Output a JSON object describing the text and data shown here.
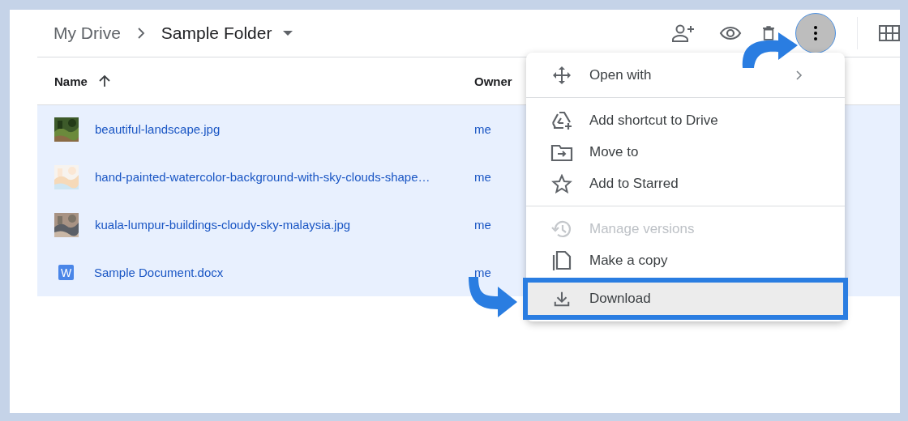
{
  "breadcrumb": [
    {
      "label": "My Drive",
      "current": false
    },
    {
      "label": "Sample Folder",
      "current": true
    }
  ],
  "table": {
    "columns": [
      "Name",
      "Owner"
    ],
    "rows": [
      {
        "name": "beautiful-landscape.jpg",
        "owner": "me",
        "selected": true
      },
      {
        "name": "hand-painted-watercolor-background-with-sky-clouds-shape…",
        "owner": "me",
        "selected": true
      },
      {
        "name": "kuala-lumpur-buildings-cloudy-sky-malaysia.jpg",
        "owner": "me",
        "selected": true
      },
      {
        "name": "Sample Document.docx",
        "owner": "me",
        "kind": "document",
        "badge": "W",
        "selected": true
      }
    ]
  },
  "menu": {
    "groups": [
      [
        {
          "label": "Open with",
          "submenu": true,
          "disabled": false,
          "selected": false
        }
      ],
      [
        {
          "label": "Add shortcut to Drive",
          "submenu": false,
          "disabled": false,
          "selected": false
        },
        {
          "label": "Move to",
          "submenu": false,
          "disabled": false,
          "selected": false
        },
        {
          "label": "Add to Starred",
          "submenu": false,
          "disabled": false,
          "selected": false
        }
      ],
      [
        {
          "label": "Manage versions",
          "submenu": false,
          "disabled": true,
          "selected": false
        },
        {
          "label": "Make a copy",
          "submenu": false,
          "disabled": false,
          "selected": false
        },
        {
          "label": "Download",
          "submenu": false,
          "disabled": false,
          "selected": true
        }
      ]
    ]
  }
}
